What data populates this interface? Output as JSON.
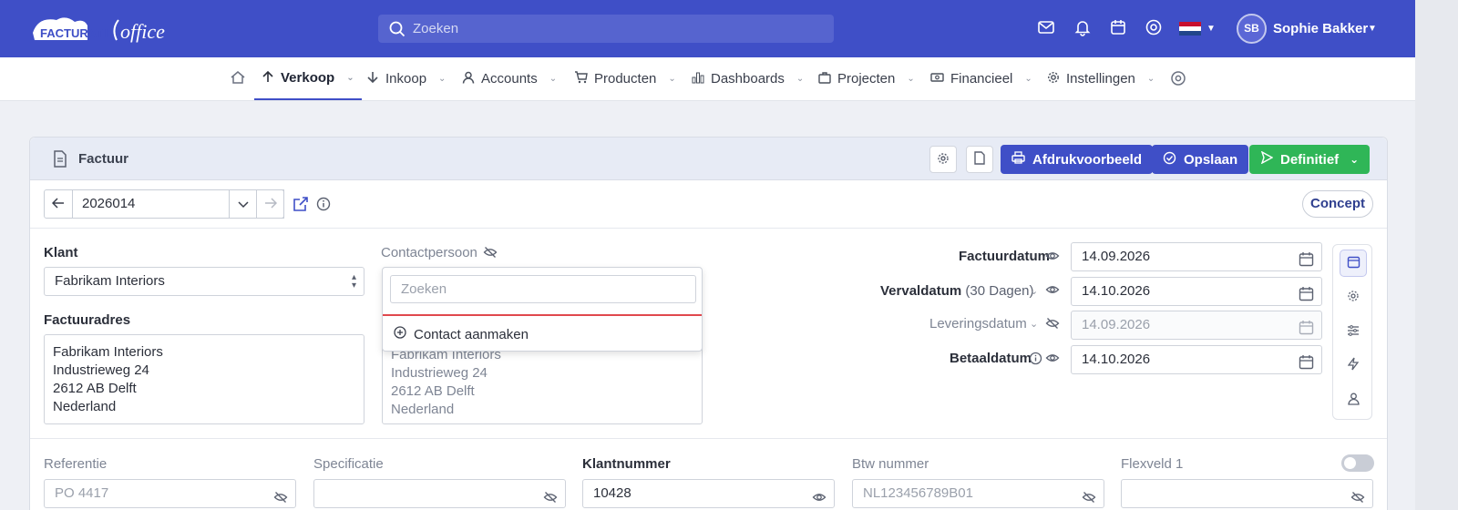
{
  "app": {
    "logo_text": "FACTURATIEoffice",
    "search_placeholder": "Zoeken",
    "user_initials": "SB",
    "user_name": "Sophie Bakker"
  },
  "nav": {
    "items": [
      {
        "label": "Verkoop",
        "icon": "arrow-up-icon",
        "active": true
      },
      {
        "label": "Inkoop",
        "icon": "arrow-down-icon"
      },
      {
        "label": "Accounts",
        "icon": "person-icon"
      },
      {
        "label": "Producten",
        "icon": "cart-icon"
      },
      {
        "label": "Dashboards",
        "icon": "bar-chart-icon"
      },
      {
        "label": "Projecten",
        "icon": "briefcase-icon"
      },
      {
        "label": "Financieel",
        "icon": "money-icon"
      },
      {
        "label": "Instellingen",
        "icon": "gear-icon"
      }
    ]
  },
  "invoice": {
    "title": "Factuur",
    "buttons": {
      "preview": "Afdrukvoorbeeld",
      "save": "Opslaan",
      "final": "Definitief"
    },
    "number": "2026014",
    "status": "Concept"
  },
  "customer": {
    "klant_label": "Klant",
    "klant_value": "Fabrikam Interiors",
    "adres_label": "Factuuradres",
    "adres_lines": [
      "Fabrikam Interiors",
      "Industrieweg 24",
      "2612 AB Delft",
      "Nederland"
    ],
    "contact_label": "Contactpersoon",
    "contact_search_placeholder": "Zoeken",
    "contact_create": "Contact aanmaken",
    "contact_adres_lines": [
      "Fabrikam Interiors",
      "Industrieweg 24",
      "2612 AB Delft",
      "Nederland"
    ]
  },
  "dates": {
    "factuurdatum_label": "Factuurdatum",
    "factuurdatum": "14.09.2026",
    "vervaldatum_label": "Vervaldatum",
    "vervaldatum_suffix": "(30 Dagen)",
    "vervaldatum": "14.10.2026",
    "leveringsdatum_label": "Leveringsdatum",
    "leveringsdatum": "14.09.2026",
    "betaaldatum_label": "Betaaldatum",
    "betaaldatum": "14.10.2026"
  },
  "extra_fields": {
    "referentie_label": "Referentie",
    "referentie_placeholder": "PO 4417",
    "specificatie_label": "Specificatie",
    "specificatie_value": "",
    "klantnummer_label": "Klantnummer",
    "klantnummer_value": "10428",
    "btw_label": "Btw nummer",
    "btw_placeholder": "NL123456789B01",
    "flexveld_label": "Flexveld 1"
  },
  "colors": {
    "primary": "#3f4fc7",
    "success": "#2fb657",
    "danger_line": "#e0484d"
  }
}
